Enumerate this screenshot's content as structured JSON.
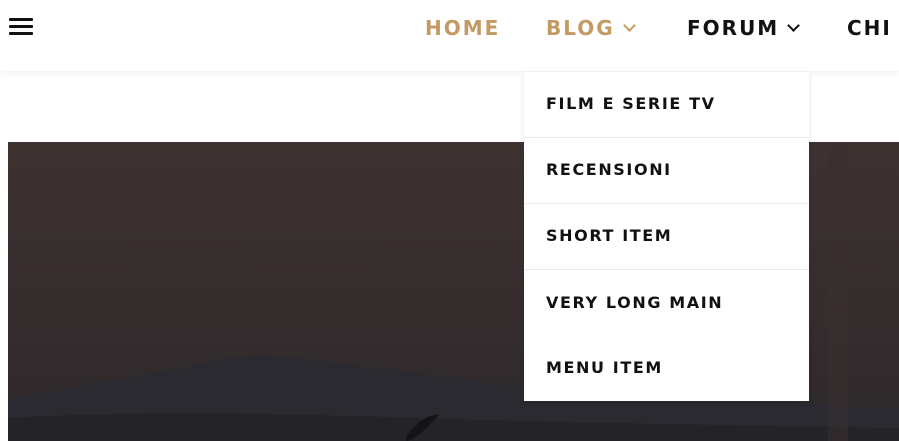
{
  "header": {
    "menu_icon": "hamburger-menu-icon",
    "nav": [
      {
        "label": "HOME",
        "active_color": "#c49a63"
      },
      {
        "label": "BLOG",
        "has_dropdown": true,
        "active_color": "#c49a63"
      },
      {
        "label": "FORUM",
        "has_dropdown": true
      },
      {
        "label": "CHI S"
      }
    ]
  },
  "dropdown": {
    "items": [
      {
        "label": "FILM E SERIE TV"
      },
      {
        "label": "RECENSIONI"
      },
      {
        "label": "SHORT ITEM"
      },
      {
        "label": "VERY LONG MAIN MENU ITEM"
      }
    ]
  },
  "colors": {
    "accent": "#c49a63",
    "text": "#111111",
    "hero_dark": "#3d3130"
  }
}
